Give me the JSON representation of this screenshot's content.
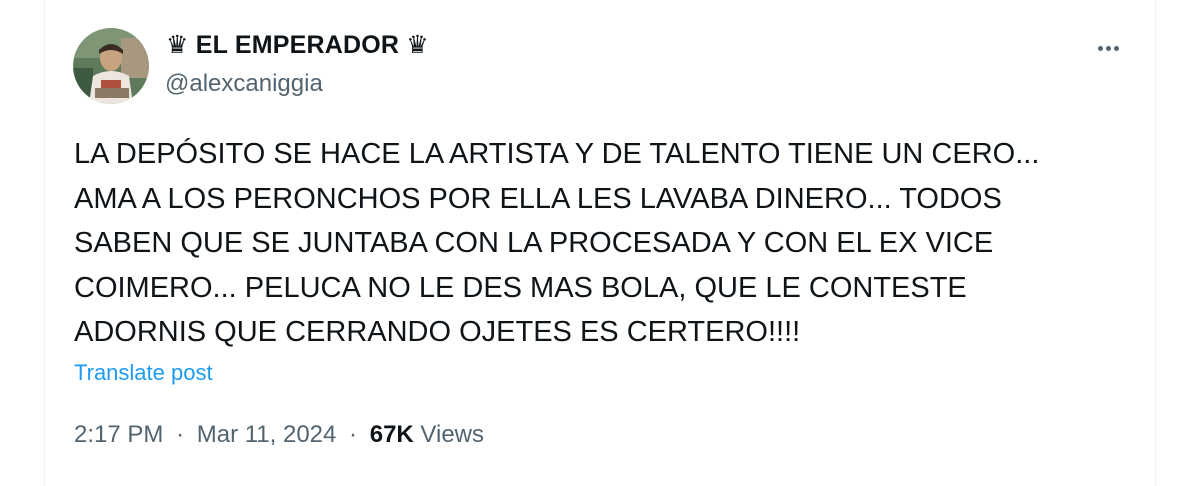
{
  "author": {
    "crown_icon": "crown",
    "display_name": "EL EMPERADOR",
    "handle": "@alexcaniggia"
  },
  "tweet": {
    "lines": [
      "LA DEPÓSITO SE HACE LA ARTISTA Y DE TALENTO TIENE UN CERO...",
      "AMA A LOS PERONCHOS POR ELLA LES LAVABA DINERO... TODOS",
      "SABEN QUE SE JUNTABA CON LA PROCESADA Y CON EL EX VICE",
      "COIMERO... PELUCA NO LE DES MAS BOLA, QUE LE CONTESTE",
      "ADORNIS QUE CERRANDO OJETES ES CERTERO!!!!"
    ],
    "translate_label": "Translate post"
  },
  "meta": {
    "time": "2:17 PM",
    "date": "Mar 11, 2024",
    "separator": "·",
    "views_count": "67K",
    "views_label": "Views"
  },
  "colors": {
    "text_primary": "#0f1419",
    "text_secondary": "#536471",
    "link": "#1d9bf0",
    "border": "#eff3f4"
  }
}
